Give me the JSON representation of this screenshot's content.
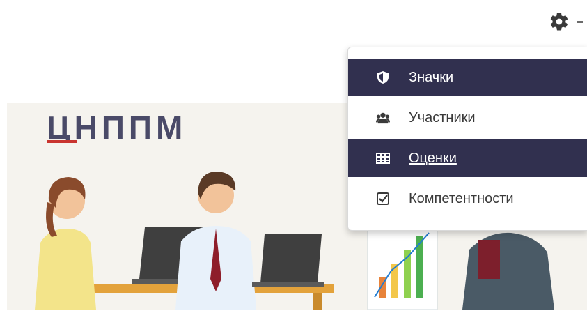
{
  "header": {
    "settings_icon": "gear-icon",
    "dropdown_icon": "caret-down-icon"
  },
  "banner": {
    "logo_text": "ЦНППМ"
  },
  "menu": {
    "items": [
      {
        "label": "Значки",
        "icon": "shield-icon",
        "highlighted": true
      },
      {
        "label": "Участники",
        "icon": "users-icon",
        "highlighted": false
      },
      {
        "label": "Оценки",
        "icon": "table-icon",
        "highlighted": true
      },
      {
        "label": "Компетентности",
        "icon": "checkbox-icon",
        "highlighted": false
      }
    ]
  },
  "colors": {
    "menu_highlight": "#31304f",
    "logo_dark": "#4a4a68",
    "logo_red": "#c9342f",
    "banner_bg": "#f5f3ee"
  }
}
